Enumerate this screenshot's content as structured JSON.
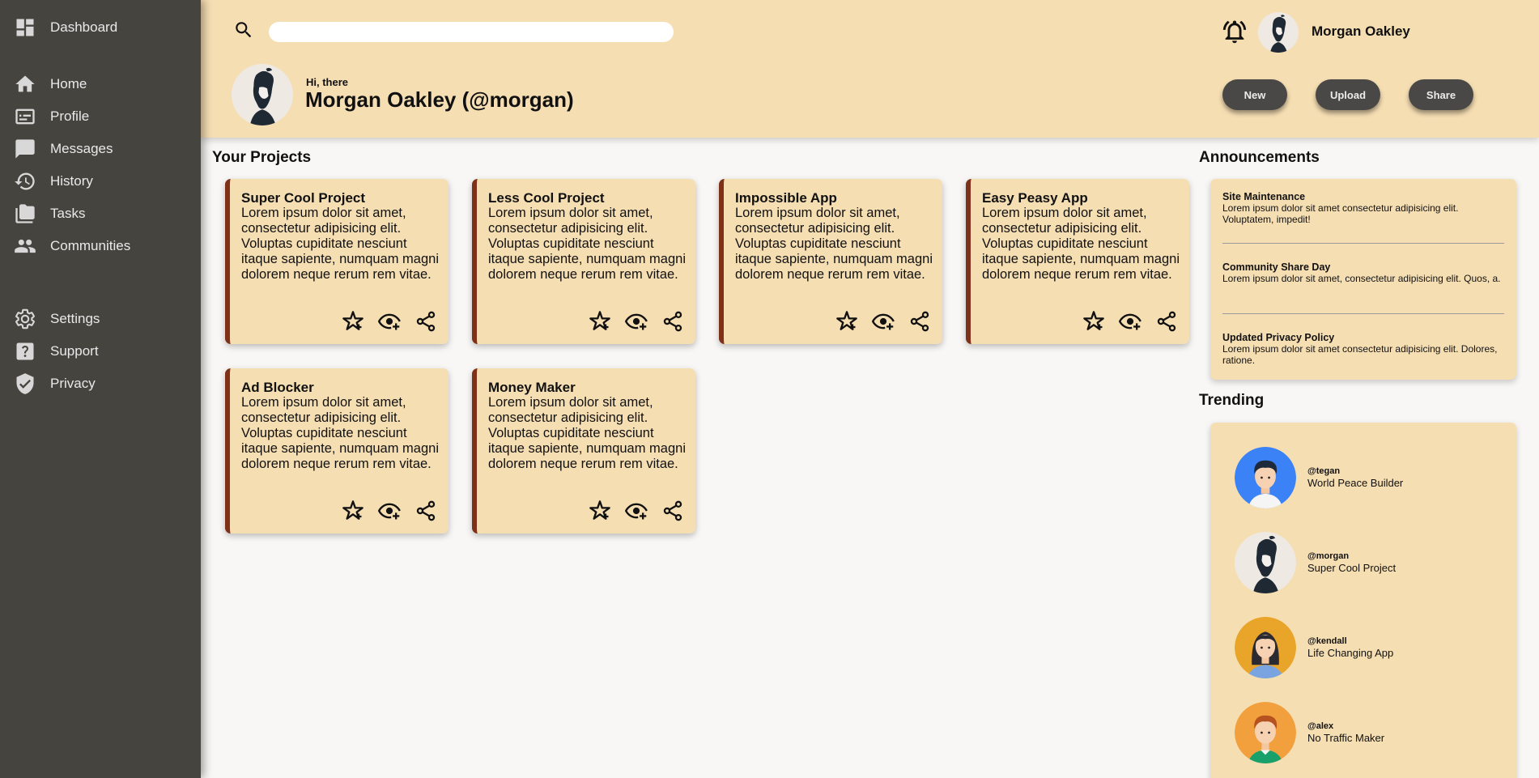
{
  "sidebar": {
    "header": "Dashboard",
    "items": [
      {
        "label": "Home",
        "icon": "home-icon"
      },
      {
        "label": "Profile",
        "icon": "profile-card-icon"
      },
      {
        "label": "Messages",
        "icon": "message-icon"
      },
      {
        "label": "History",
        "icon": "history-icon"
      },
      {
        "label": "Tasks",
        "icon": "folder-icon"
      },
      {
        "label": "Communities",
        "icon": "people-icon"
      },
      {
        "label": "Settings",
        "icon": "gear-icon"
      },
      {
        "label": "Support",
        "icon": "help-icon"
      },
      {
        "label": "Privacy",
        "icon": "shield-icon"
      }
    ]
  },
  "header": {
    "search_placeholder": "",
    "user_name": "Morgan Oakley",
    "greeting": "Hi, there",
    "full_name": "Morgan Oakley (@morgan)",
    "buttons": {
      "new": "New",
      "upload": "Upload",
      "share": "Share"
    }
  },
  "projects": {
    "title": "Your Projects",
    "items": [
      {
        "title": "Super Cool Project",
        "desc": "Lorem ipsum dolor sit amet, consectetur adipisicing elit. Voluptas cupiditate nesciunt itaque sapiente, numquam magni dolorem neque rerum rem vitae."
      },
      {
        "title": "Less Cool Project",
        "desc": "Lorem ipsum dolor sit amet, consectetur adipisicing elit. Voluptas cupiditate nesciunt itaque sapiente, numquam magni dolorem neque rerum rem vitae."
      },
      {
        "title": "Impossible App",
        "desc": "Lorem ipsum dolor sit amet, consectetur adipisicing elit. Voluptas cupiditate nesciunt itaque sapiente, numquam magni dolorem neque rerum rem vitae."
      },
      {
        "title": "Easy Peasy App",
        "desc": "Lorem ipsum dolor sit amet, consectetur adipisicing elit. Voluptas cupiditate nesciunt itaque sapiente, numquam magni dolorem neque rerum rem vitae."
      },
      {
        "title": "Ad Blocker",
        "desc": "Lorem ipsum dolor sit amet, consectetur adipisicing elit. Voluptas cupiditate nesciunt itaque sapiente, numquam magni dolorem neque rerum rem vitae."
      },
      {
        "title": "Money Maker",
        "desc": "Lorem ipsum dolor sit amet, consectetur adipisicing elit. Voluptas cupiditate nesciunt itaque sapiente, numquam magni dolorem neque rerum rem vitae."
      }
    ]
  },
  "announcements": {
    "title": "Announcements",
    "items": [
      {
        "title": "Site Maintenance",
        "body": "Lorem ipsum dolor sit amet consectetur adipisicing elit. Voluptatem, impedit!"
      },
      {
        "title": "Community Share Day",
        "body": "Lorem ipsum dolor sit amet, consectetur adipisicing elit. Quos, a."
      },
      {
        "title": "Updated Privacy Policy",
        "body": "Lorem ipsum dolor sit amet consectetur adipisicing elit. Dolores, ratione."
      }
    ]
  },
  "trending": {
    "title": "Trending",
    "items": [
      {
        "handle": "@tegan",
        "project": "World Peace Builder",
        "avatar_bg": "#3b82f6"
      },
      {
        "handle": "@morgan",
        "project": "Super Cool Project",
        "avatar_bg": "#efe9e3"
      },
      {
        "handle": "@kendall",
        "project": "Life Changing App",
        "avatar_bg": "#e8a52a"
      },
      {
        "handle": "@alex",
        "project": "No Traffic Maker",
        "avatar_bg": "#f2a03d"
      }
    ]
  },
  "colors": {
    "sidebar": "#46443f",
    "header": "#f6deb3",
    "card": "#f6deb3",
    "card_accent": "#7e3118",
    "button": "#4a4846"
  }
}
